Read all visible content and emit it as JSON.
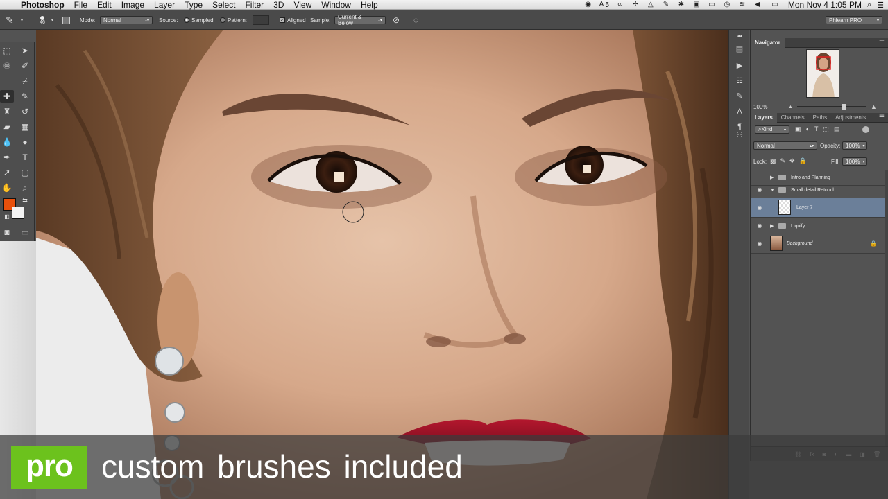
{
  "menubar": {
    "app_name": "Photoshop",
    "items": [
      "File",
      "Edit",
      "Image",
      "Layer",
      "Type",
      "Select",
      "Filter",
      "3D",
      "View",
      "Window",
      "Help"
    ],
    "status_badge": "5",
    "clock": "Mon Nov 4  1:05 PM"
  },
  "options": {
    "brush_size": "46",
    "mode_label": "Mode:",
    "mode_value": "Normal",
    "source_label": "Source:",
    "sampled_label": "Sampled",
    "pattern_label": "Pattern:",
    "aligned_label": "Aligned",
    "sample_label": "Sample:",
    "sample_value": "Current & Below",
    "workspace": "Phlearn PRO"
  },
  "colors": {
    "foreground": "#e8500c",
    "background": "#f2f2f2",
    "pro_green": "#6cc21d",
    "selected_layer": "#6b7f99"
  },
  "navigator": {
    "tab": "Navigator",
    "zoom": "100%"
  },
  "layers_panel": {
    "tabs": [
      "Layers",
      "Channels",
      "Paths",
      "Adjustments"
    ],
    "filter_kind": "Kind",
    "blend_mode": "Normal",
    "opacity_label": "Opacity:",
    "opacity_value": "100%",
    "lock_label": "Lock:",
    "fill_label": "Fill:",
    "fill_value": "100%",
    "layers": [
      {
        "name": "Intro and Planning"
      },
      {
        "name": "Small detail Retouch"
      },
      {
        "name": "Layer 7"
      },
      {
        "name": "Liquify"
      },
      {
        "name": "Background"
      }
    ]
  },
  "banner": {
    "badge": "pro",
    "text": "custom brushes included"
  }
}
